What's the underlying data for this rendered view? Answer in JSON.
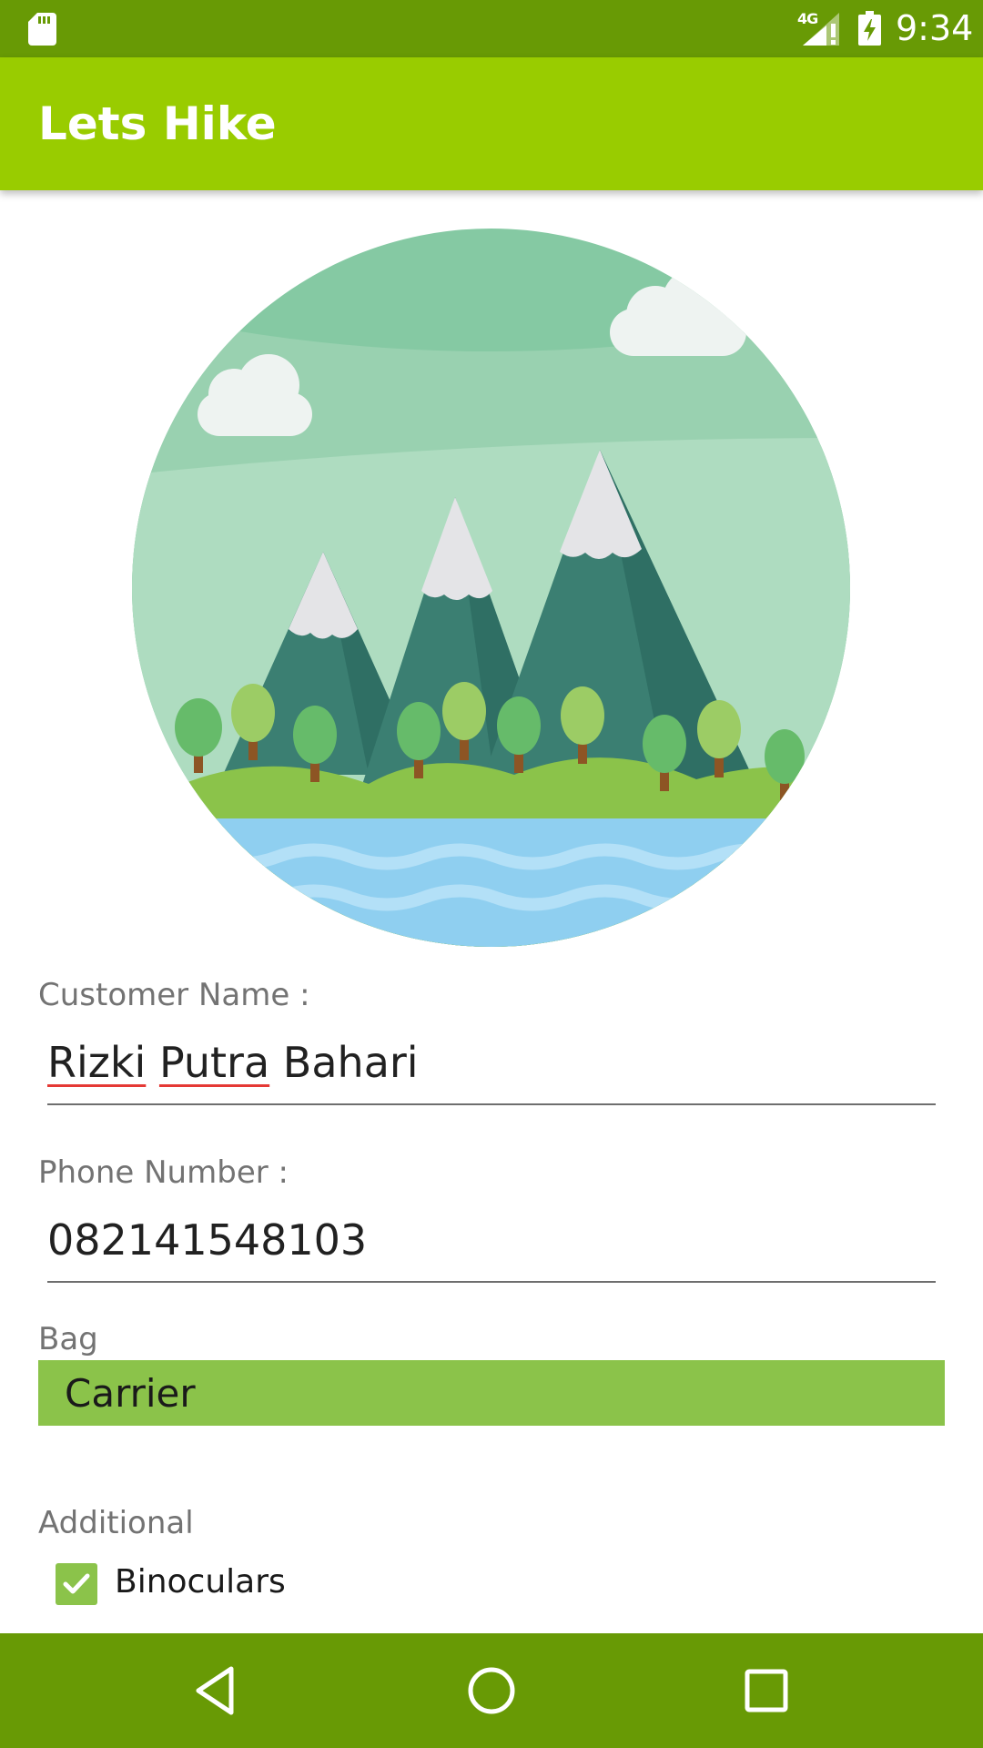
{
  "status_bar": {
    "network_label": "4G",
    "time": "9:34",
    "icons": [
      "sd-card-icon",
      "signal-icon",
      "battery-charging-icon"
    ]
  },
  "app_bar": {
    "title": "Lets Hike"
  },
  "hero": {
    "icon": "mountain-landscape-illustration"
  },
  "form": {
    "customer_name": {
      "label": "Customer Name :",
      "value_words": [
        "Rizki",
        "Putra",
        "Bahari"
      ]
    },
    "phone_number": {
      "label": "Phone Number :",
      "value": "082141548103"
    },
    "bag": {
      "label": "Bag",
      "selected": "Carrier"
    },
    "additional": {
      "label": "Additional",
      "options": [
        {
          "label": "Binoculars",
          "checked": true
        }
      ]
    }
  },
  "nav_bar": {
    "buttons": [
      "back-icon",
      "home-icon",
      "recents-icon"
    ]
  },
  "colors": {
    "status_bar": "#689a05",
    "app_bar": "#99cc00",
    "accent": "#8bc34a",
    "nav_bar": "#689a05"
  }
}
